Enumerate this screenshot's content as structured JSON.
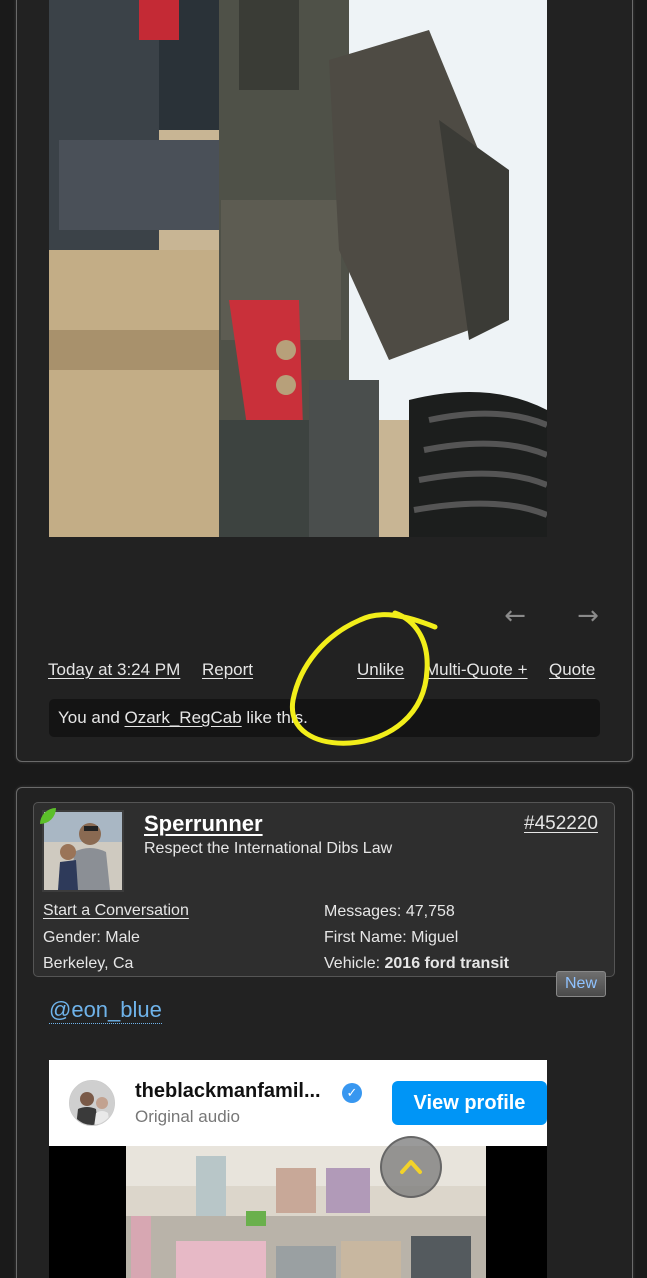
{
  "post1": {
    "timestamp": "Today at 3:24 PM",
    "report_label": "Report",
    "unlike_label": "Unlike",
    "multiquote_label": "Multi-Quote +",
    "quote_label": "Quote",
    "likes": {
      "prefix": "You and ",
      "user": "Ozark_RegCab",
      "suffix": " like this."
    }
  },
  "post2": {
    "username": "Sperrunner",
    "user_title": "Respect the International Dibs Law",
    "post_number": "#452220",
    "start_conversation": "Start a Conversation",
    "gender_label": "Gender:",
    "gender_value": "Male",
    "location": "Berkeley, Ca",
    "messages_label": "Messages:",
    "messages_value": "47,758",
    "first_name_label": "First Name:",
    "first_name_value": "Miguel",
    "vehicle_label": "Vehicle:",
    "vehicle_value": "2016 ford transit",
    "new_badge": "New",
    "mention": "@eon_blue",
    "embed": {
      "account": "theblackmanfamil...",
      "subtitle": "Original audio",
      "view_profile": "View profile"
    }
  },
  "colors": {
    "background": "#1a1a1a",
    "panel": "#222222",
    "link_blue": "#6fb3ea",
    "instagram_blue": "#0095f6",
    "annotation_yellow": "#f2ee1a"
  }
}
